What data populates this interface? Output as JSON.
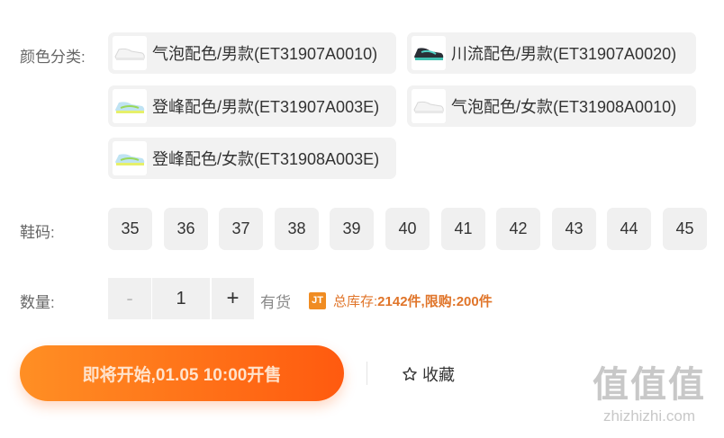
{
  "color": {
    "label": "颜色分类:",
    "options": [
      {
        "text": "气泡配色/男款(ET31907A0010)",
        "thumb_icon": "white-sneaker-icon"
      },
      {
        "text": "川流配色/男款(ET31907A0020)",
        "thumb_icon": "dark-sneaker-icon"
      },
      {
        "text": "登峰配色/男款(ET31907A003E)",
        "thumb_icon": "lightblue-sneaker-icon"
      },
      {
        "text": "气泡配色/女款(ET31908A0010)",
        "thumb_icon": "white-sneaker-icon"
      },
      {
        "text": "登峰配色/女款(ET31908A003E)",
        "thumb_icon": "lightblue-sneaker-icon"
      }
    ]
  },
  "size": {
    "label": "鞋码:",
    "options": [
      "35",
      "36",
      "37",
      "38",
      "39",
      "40",
      "41",
      "42",
      "43",
      "44",
      "45"
    ]
  },
  "quantity": {
    "label": "数量:",
    "minus": "-",
    "value": "1",
    "plus": "+",
    "stock_text": "有货",
    "badge": "JT",
    "stock_prefix": "总库存:",
    "stock_info": "2142件,限购:200件"
  },
  "actions": {
    "buy_label": "即将开始,01.05 10:00开售",
    "favorite_label": "收藏"
  },
  "watermark": {
    "logo_text": "值值值",
    "domain": "zhizhizhi.com"
  },
  "colors": {
    "accent": "#ff6a12",
    "stock_accent": "#e0752a"
  }
}
